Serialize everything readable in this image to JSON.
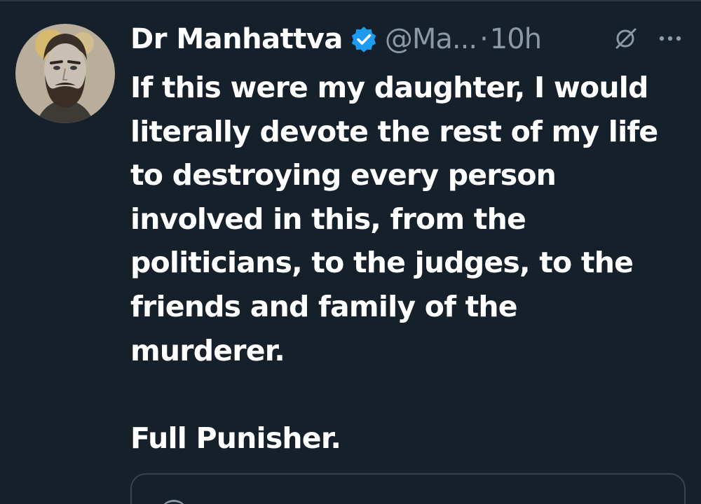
{
  "tweet": {
    "author": {
      "display_name": "Dr Manhattva",
      "handle": "@Ma...",
      "separator": "·",
      "time": "10h",
      "verified": true,
      "verified_color": "#1d9bf0"
    },
    "body_lines": [
      "If this were my daughter, I would",
      "literally devote the rest of my life",
      "to destroying every person",
      "involved in this, from the",
      "politicians, to the judges, to the",
      "friends and family of the",
      "murderer.",
      "",
      "Full Punisher."
    ],
    "icons": {
      "avatar": "avatar-icon",
      "verified": "verified-badge-icon",
      "grok": "grok-icon",
      "more": "more-options-icon"
    }
  },
  "theme": {
    "background": "#15202b",
    "text_primary": "#ffffff",
    "text_secondary": "#8b98a5",
    "border": "#38444d"
  }
}
